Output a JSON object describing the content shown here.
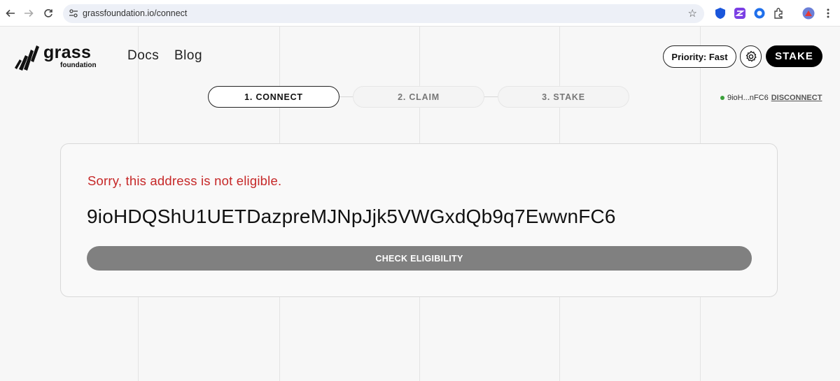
{
  "browser": {
    "url": "grassfoundation.io/connect"
  },
  "header": {
    "logo_word": "grass",
    "logo_sub": "foundation",
    "nav": [
      {
        "label": "Docs"
      },
      {
        "label": "Blog"
      }
    ],
    "priority_label": "Priority: Fast",
    "stake_label": "STAKE"
  },
  "steps": [
    {
      "label": "1. CONNECT",
      "active": true
    },
    {
      "label": "2. CLAIM",
      "active": false
    },
    {
      "label": "3. STAKE",
      "active": false
    }
  ],
  "wallet": {
    "short_address": "9ioH...nFC6",
    "disconnect_label": "DISCONNECT",
    "status_color": "#3aa03a"
  },
  "eligibility": {
    "message": "Sorry, this address is not eligible.",
    "message_color": "#c62828",
    "address": "9ioHDQShU1UETDazpreMJNpJjk5VWGxdQb9q7EwwnFC6",
    "check_label": "CHECK ELIGIBILITY"
  },
  "icons": {
    "back": "arrow-left-icon",
    "forward": "arrow-right-icon",
    "reload": "reload-icon",
    "site_info": "tune-icon",
    "bookmark": "star-icon",
    "settings": "gear-icon",
    "menu": "more-vert-icon"
  }
}
